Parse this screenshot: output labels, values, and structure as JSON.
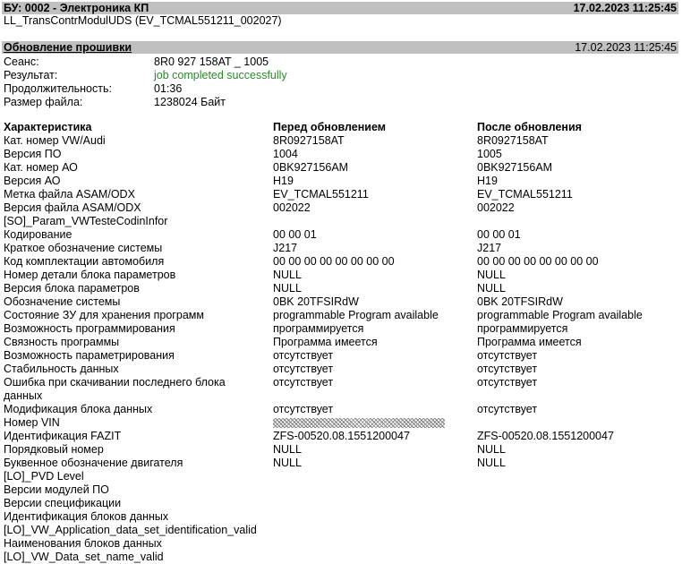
{
  "header": {
    "title": "БУ: 0002 - Электроника КП",
    "datetime": "17.02.2023 11:25:45",
    "subtitle": "LL_TransContrModulUDS (EV_TCMAL551211_002027)"
  },
  "update": {
    "section_title": "Обновление прошивки",
    "datetime": "17.02.2023 11:25:45",
    "fields": [
      {
        "label": "Сеанс:",
        "value": "8R0 927 158AT _ 1005"
      },
      {
        "label": "Результат:",
        "value": "job completed successfully"
      },
      {
        "label": "Продолжительность:",
        "value": "01:36"
      },
      {
        "label": "Размер файла:",
        "value": "1238024 Байт"
      }
    ]
  },
  "table": {
    "headers": [
      "Характеристика",
      "Перед обновлением",
      "После обновления"
    ],
    "rows": [
      {
        "name": "Кат. номер VW/Audi",
        "before": "8R0927158AT",
        "after": "8R0927158AT"
      },
      {
        "name": "Версия ПО",
        "before": "1004",
        "after": "1005"
      },
      {
        "name": "Кат. номер АО",
        "before": "0BK927156AM",
        "after": "0BK927156AM"
      },
      {
        "name": "Версия АО",
        "before": "H19",
        "after": "H19"
      },
      {
        "name": "Метка файла ASAM/ODX",
        "before": "EV_TCMAL551211",
        "after": "EV_TCMAL551211"
      },
      {
        "name": "Версия файла ASAM/ODX",
        "before": "002022",
        "after": "002022"
      },
      {
        "name": "[SO]_Param_VWTesteCodinInfor",
        "before": "",
        "after": ""
      },
      {
        "name": "Кодирование",
        "before": "00 00 01",
        "after": "00 00 01"
      },
      {
        "name": "Краткое обозначение системы",
        "before": "J217",
        "after": "J217"
      },
      {
        "name": "Код комплектации автомобиля",
        "before": "00 00 00 00 00 00 00 00",
        "after": "00 00 00 00 00 00 00 00"
      },
      {
        "name": "Номер детали блока параметров",
        "before": "NULL",
        "after": "NULL"
      },
      {
        "name": "Версия блока параметров",
        "before": "NULL",
        "after": "NULL"
      },
      {
        "name": "Обозначение системы",
        "before": "0BK 20TFSIRdW",
        "after": "0BK 20TFSIRdW"
      },
      {
        "name": "Состояние ЗУ для хранения программ",
        "before": "programmable Program available",
        "after": "programmable Program available"
      },
      {
        "name": "Возможность программирования",
        "before": "программируется",
        "after": "программируется"
      },
      {
        "name": "Связность программы",
        "before": "Программа имеется",
        "after": "Программа имеется"
      },
      {
        "name": "Возможность параметрирования",
        "before": "отсутствует",
        "after": "отсутствует"
      },
      {
        "name": "Стабильность данных",
        "before": "отсутствует",
        "after": "отсутствует"
      },
      {
        "name": "Ошибка при скачивании последнего блока данных",
        "before": "отсутствует",
        "after": "отсутствует"
      },
      {
        "name": "Модификация блока данных",
        "before": "отсутствует",
        "after": "отсутствует"
      },
      {
        "name": "Номер VIN",
        "before": "",
        "after": ""
      },
      {
        "name": "Идентификация FAZIT",
        "before": "ZFS-00520.08.1551200047",
        "after": "ZFS-00520.08.1551200047"
      },
      {
        "name": "Порядковый номер",
        "before": "NULL",
        "after": "NULL"
      },
      {
        "name": "Буквенное обозначение двигателя",
        "before": "NULL",
        "after": "NULL"
      },
      {
        "name": "[LO]_PVD Level",
        "before": "",
        "after": ""
      },
      {
        "name": "Версии модулей ПО",
        "before": "",
        "after": ""
      },
      {
        "name": "Версии спецификации",
        "before": "",
        "after": ""
      },
      {
        "name": "Идентификация блоков данных",
        "before": "",
        "after": ""
      },
      {
        "name": "[LO]_VW_Application_data_set_identification_valid",
        "before": "",
        "after": ""
      },
      {
        "name": "Наименования блоков данных",
        "before": "",
        "after": ""
      },
      {
        "name": "[LO]_VW_Data_set_name_valid",
        "before": "",
        "after": ""
      }
    ]
  }
}
